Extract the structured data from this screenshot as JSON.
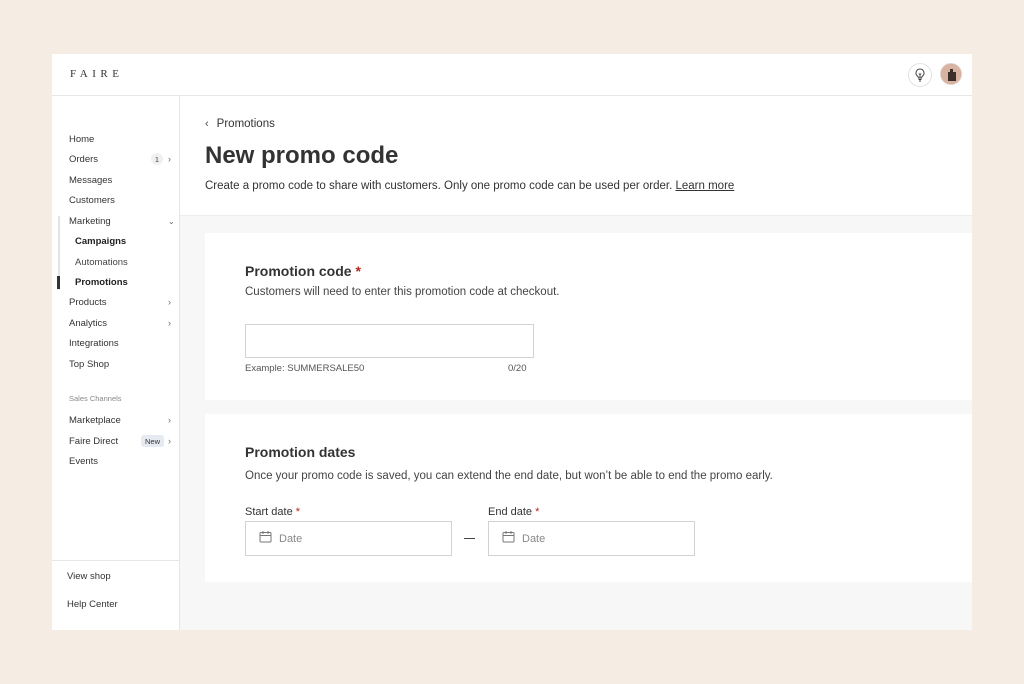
{
  "app": {
    "logo": "FAIRE"
  },
  "topbar": {
    "tips_icon": "lightbulb-icon",
    "avatar_icon": "avatar-icon"
  },
  "sidebar": {
    "items": [
      {
        "label": "Home"
      },
      {
        "label": "Orders",
        "badge": "1"
      },
      {
        "label": "Messages"
      },
      {
        "label": "Customers"
      },
      {
        "label": "Marketing"
      },
      {
        "label": "Campaigns"
      },
      {
        "label": "Automations"
      },
      {
        "label": "Promotions"
      },
      {
        "label": "Products"
      },
      {
        "label": "Analytics"
      },
      {
        "label": "Integrations"
      },
      {
        "label": "Top Shop"
      }
    ],
    "section_label": "Sales Channels",
    "channels": [
      {
        "label": "Marketplace"
      },
      {
        "label": "Faire Direct",
        "badge": "New"
      },
      {
        "label": "Events"
      }
    ],
    "footer": {
      "view_shop": "View shop",
      "help_center": "Help Center"
    }
  },
  "header": {
    "back_label": "Promotions",
    "title": "New promo code",
    "description": "Create a promo code to share with customers. Only one promo code can be used per order.",
    "learn_more": "Learn more"
  },
  "promo_code_card": {
    "title": "Promotion code",
    "required_mark": "*",
    "description": "Customers will need to enter this promotion code at checkout.",
    "input_value": "",
    "example": "Example: SUMMERSALE50",
    "counter": "0/20"
  },
  "dates_card": {
    "title": "Promotion dates",
    "description": "Once your promo code is saved, you can extend the end date, but won’t be able to end the promo early.",
    "start_label": "Start date",
    "end_label": "End date",
    "required_mark": "*",
    "start_placeholder": "Date",
    "end_placeholder": "Date"
  },
  "colors": {
    "page_bg": "#f5ece3",
    "required": "#b3261e",
    "badge_new_bg": "#e6eaf1"
  }
}
